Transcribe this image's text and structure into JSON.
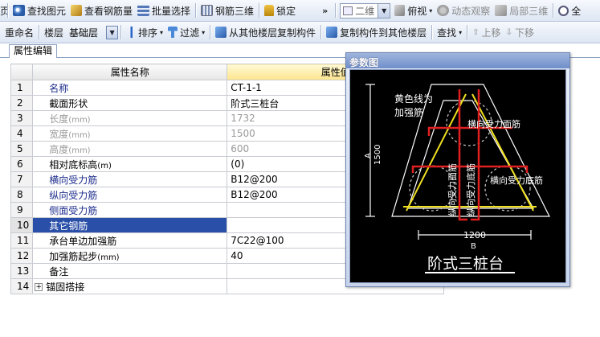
{
  "toolbar1": {
    "items": [
      {
        "icon": "eye-icon",
        "label": "查找图元"
      },
      {
        "icon": "view-rebar-icon",
        "label": "查看钢筋量"
      },
      {
        "icon": "batch-select-icon",
        "label": "批量选择"
      },
      {
        "icon": "rebar-3d-icon",
        "label": "钢筋三维"
      },
      {
        "icon": "lock-icon",
        "label": "锁定"
      }
    ],
    "more_label": "»",
    "view_mode_value": "二维",
    "view_items": [
      {
        "icon": "top-view-icon",
        "label": "俯视"
      },
      {
        "icon": "orbit-icon",
        "label": "动态观察"
      },
      {
        "icon": "local-3d-icon",
        "label": "局部三维"
      },
      {
        "icon": "zoom-all-icon",
        "label": "全"
      }
    ]
  },
  "toolbar2": {
    "rename_label": "重命名",
    "floor_label": "楼层",
    "floor_value": "基础层",
    "sort_label": "排序",
    "filter_label": "过滤",
    "copy_from_label": "从其他楼层复制构件",
    "copy_to_label": "复制构件到其他楼层",
    "find_label": "查找",
    "move_up_label": "上移",
    "move_down_label": "下移"
  },
  "tabs": {
    "property_edit": "属性编辑"
  },
  "grid": {
    "col_name": "属性名称",
    "col_value": "属性值",
    "rows": [
      {
        "num": "1",
        "name": "名称",
        "value": "CT-1-1",
        "style": "blue"
      },
      {
        "num": "2",
        "name": "截面形状",
        "value": "阶式三桩台",
        "style": ""
      },
      {
        "num": "3",
        "name": "长度",
        "unit": "(mm)",
        "value": "1732",
        "style": "gray"
      },
      {
        "num": "4",
        "name": "宽度",
        "unit": "(mm)",
        "value": "1500",
        "style": "gray"
      },
      {
        "num": "5",
        "name": "高度",
        "unit": "(mm)",
        "value": "600",
        "style": "gray"
      },
      {
        "num": "6",
        "name": "相对底标高",
        "unit": "(m)",
        "value": "(0)",
        "style": ""
      },
      {
        "num": "7",
        "name": "横向受力筋",
        "value": "B12@200",
        "style": "blue"
      },
      {
        "num": "8",
        "name": "纵向受力筋",
        "value": "B12@200",
        "style": "blue"
      },
      {
        "num": "9",
        "name": "侧面受力筋",
        "value": "",
        "style": "blue"
      },
      {
        "num": "10",
        "name": "其它钢筋",
        "value": "",
        "style": "sel"
      },
      {
        "num": "11",
        "name": "承台单边加强筋",
        "value": "7C22@100",
        "style": ""
      },
      {
        "num": "12",
        "name": "加强筋起步",
        "unit": "(mm)",
        "value": "40",
        "style": ""
      },
      {
        "num": "13",
        "name": "备注",
        "value": "",
        "style": ""
      },
      {
        "num": "14",
        "name": "锚固搭接",
        "value": "",
        "style": "expand"
      }
    ]
  },
  "dialog": {
    "title": "参数图",
    "labels": {
      "yellow_line": [
        "黄色线为",
        "加强筋"
      ],
      "horiz_top": "横向受力面筋",
      "horiz_bottom": "横向受力底筋",
      "vert_top": "纵向受力面筋",
      "vert_bottom": "纵向受力底筋",
      "dim_a": "A",
      "dim_height": "1500",
      "dim_width": "1200",
      "dim_b": "B",
      "caption": "阶式三桩台"
    },
    "colors": {
      "outline": "#ffffff",
      "rebar_red": "#e02020",
      "strengthen_yellow": "#f0e020",
      "background": "#000000"
    }
  }
}
